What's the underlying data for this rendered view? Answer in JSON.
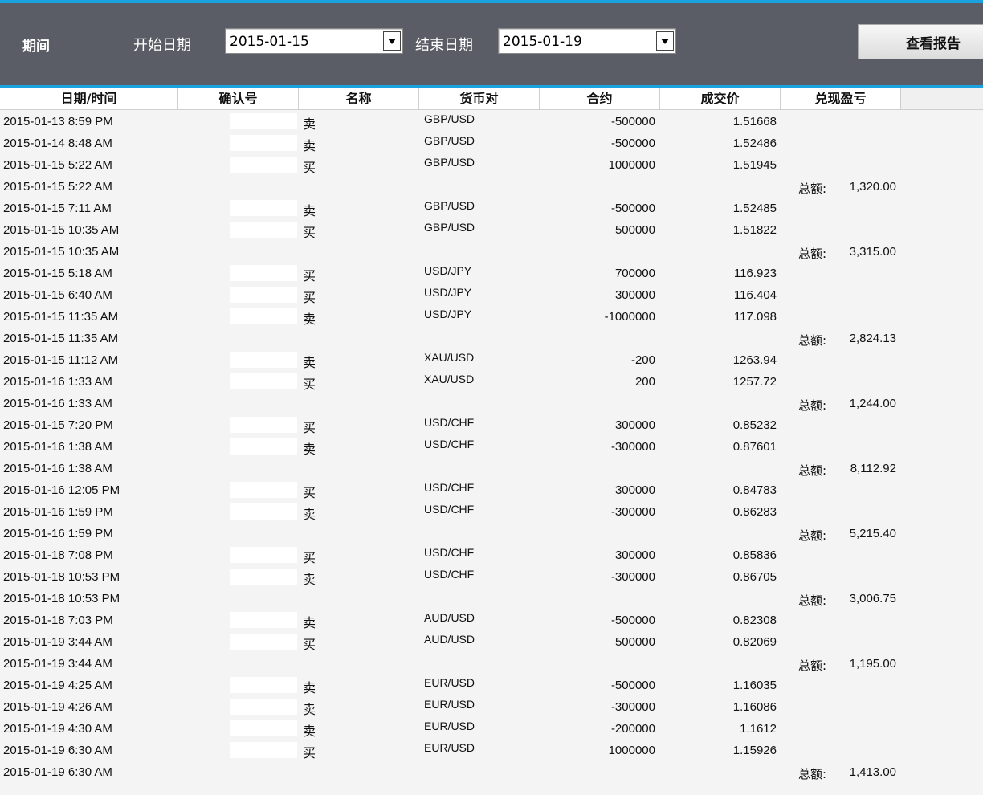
{
  "toolbar": {
    "period_label": "期间",
    "start_label": "开始日期",
    "start_value": "2015-01-15",
    "end_label": "结束日期",
    "end_value": "2015-01-19",
    "report_button": "查看报告"
  },
  "columns": [
    "日期/时间",
    "确认号",
    "名称",
    "货币对",
    "合约",
    "成交价",
    "兑现盈亏"
  ],
  "total_label": "总额:",
  "rows": [
    {
      "dt": "2015-01-13 8:59 PM",
      "side": "卖",
      "pair": "GBP/USD",
      "amount": "-500000",
      "price": "1.51668",
      "total": ""
    },
    {
      "dt": "2015-01-14 8:48 AM",
      "side": "卖",
      "pair": "GBP/USD",
      "amount": "-500000",
      "price": "1.52486",
      "total": ""
    },
    {
      "dt": "2015-01-15 5:22 AM",
      "side": "买",
      "pair": "GBP/USD",
      "amount": "1000000",
      "price": "1.51945",
      "total": ""
    },
    {
      "dt": "2015-01-15 5:22 AM",
      "side": "",
      "pair": "",
      "amount": "",
      "price": "",
      "total": "1,320.00"
    },
    {
      "dt": "2015-01-15 7:11 AM",
      "side": "卖",
      "pair": "GBP/USD",
      "amount": "-500000",
      "price": "1.52485",
      "total": ""
    },
    {
      "dt": "2015-01-15 10:35 AM",
      "side": "买",
      "pair": "GBP/USD",
      "amount": "500000",
      "price": "1.51822",
      "total": ""
    },
    {
      "dt": "2015-01-15 10:35 AM",
      "side": "",
      "pair": "",
      "amount": "",
      "price": "",
      "total": "3,315.00"
    },
    {
      "dt": "2015-01-15 5:18 AM",
      "side": "买",
      "pair": "USD/JPY",
      "amount": "700000",
      "price": "116.923",
      "total": ""
    },
    {
      "dt": "2015-01-15 6:40 AM",
      "side": "买",
      "pair": "USD/JPY",
      "amount": "300000",
      "price": "116.404",
      "total": ""
    },
    {
      "dt": "2015-01-15 11:35 AM",
      "side": "卖",
      "pair": "USD/JPY",
      "amount": "-1000000",
      "price": "117.098",
      "total": ""
    },
    {
      "dt": "2015-01-15 11:35 AM",
      "side": "",
      "pair": "",
      "amount": "",
      "price": "",
      "total": "2,824.13"
    },
    {
      "dt": "2015-01-15 11:12 AM",
      "side": "卖",
      "pair": "XAU/USD",
      "amount": "-200",
      "price": "1263.94",
      "total": ""
    },
    {
      "dt": "2015-01-16 1:33 AM",
      "side": "买",
      "pair": "XAU/USD",
      "amount": "200",
      "price": "1257.72",
      "total": ""
    },
    {
      "dt": "2015-01-16 1:33 AM",
      "side": "",
      "pair": "",
      "amount": "",
      "price": "",
      "total": "1,244.00"
    },
    {
      "dt": "2015-01-15 7:20 PM",
      "side": "买",
      "pair": "USD/CHF",
      "amount": "300000",
      "price": "0.85232",
      "total": ""
    },
    {
      "dt": "2015-01-16 1:38 AM",
      "side": "卖",
      "pair": "USD/CHF",
      "amount": "-300000",
      "price": "0.87601",
      "total": ""
    },
    {
      "dt": "2015-01-16 1:38 AM",
      "side": "",
      "pair": "",
      "amount": "",
      "price": "",
      "total": "8,112.92"
    },
    {
      "dt": "2015-01-16 12:05 PM",
      "side": "买",
      "pair": "USD/CHF",
      "amount": "300000",
      "price": "0.84783",
      "total": ""
    },
    {
      "dt": "2015-01-16 1:59 PM",
      "side": "卖",
      "pair": "USD/CHF",
      "amount": "-300000",
      "price": "0.86283",
      "total": ""
    },
    {
      "dt": "2015-01-16 1:59 PM",
      "side": "",
      "pair": "",
      "amount": "",
      "price": "",
      "total": "5,215.40"
    },
    {
      "dt": "2015-01-18 7:08 PM",
      "side": "买",
      "pair": "USD/CHF",
      "amount": "300000",
      "price": "0.85836",
      "total": ""
    },
    {
      "dt": "2015-01-18 10:53 PM",
      "side": "卖",
      "pair": "USD/CHF",
      "amount": "-300000",
      "price": "0.86705",
      "total": ""
    },
    {
      "dt": "2015-01-18 10:53 PM",
      "side": "",
      "pair": "",
      "amount": "",
      "price": "",
      "total": "3,006.75"
    },
    {
      "dt": "2015-01-18 7:03 PM",
      "side": "卖",
      "pair": "AUD/USD",
      "amount": "-500000",
      "price": "0.82308",
      "total": ""
    },
    {
      "dt": "2015-01-19 3:44 AM",
      "side": "买",
      "pair": "AUD/USD",
      "amount": "500000",
      "price": "0.82069",
      "total": ""
    },
    {
      "dt": "2015-01-19 3:44 AM",
      "side": "",
      "pair": "",
      "amount": "",
      "price": "",
      "total": "1,195.00"
    },
    {
      "dt": "2015-01-19 4:25 AM",
      "side": "卖",
      "pair": "EUR/USD",
      "amount": "-500000",
      "price": "1.16035",
      "total": ""
    },
    {
      "dt": "2015-01-19 4:26 AM",
      "side": "卖",
      "pair": "EUR/USD",
      "amount": "-300000",
      "price": "1.16086",
      "total": ""
    },
    {
      "dt": "2015-01-19 4:30 AM",
      "side": "卖",
      "pair": "EUR/USD",
      "amount": "-200000",
      "price": "1.1612",
      "total": ""
    },
    {
      "dt": "2015-01-19 6:30 AM",
      "side": "买",
      "pair": "EUR/USD",
      "amount": "1000000",
      "price": "1.15926",
      "total": ""
    },
    {
      "dt": "2015-01-19 6:30 AM",
      "side": "",
      "pair": "",
      "amount": "",
      "price": "",
      "total": "1,413.00"
    }
  ]
}
